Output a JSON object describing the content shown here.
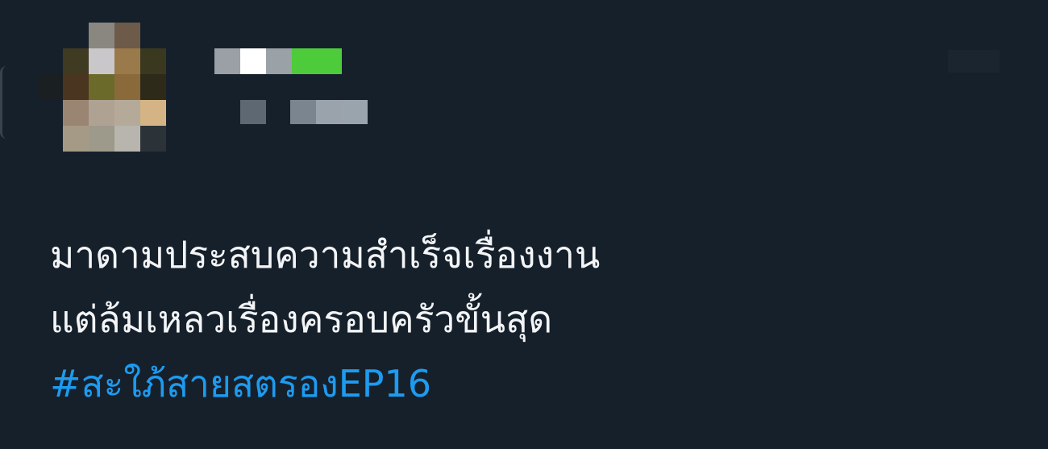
{
  "tweet": {
    "author": {
      "avatar_icon": "avatar-pixelated",
      "display_name_redacted": true,
      "handle_redacted": true
    },
    "text_lines": [
      "มาดามประสบความสำเร็จเรื่องงาน",
      "แต่ล้มเหลวเรื่องครอบครัวขั้นสุด"
    ],
    "hashtag": "#สะใภ้สายสตรองEP16"
  },
  "colors": {
    "background": "#16202b",
    "text": "#f2f4f6",
    "hashtag": "#1d9bf0",
    "name_accent": "#4ecb3a"
  }
}
